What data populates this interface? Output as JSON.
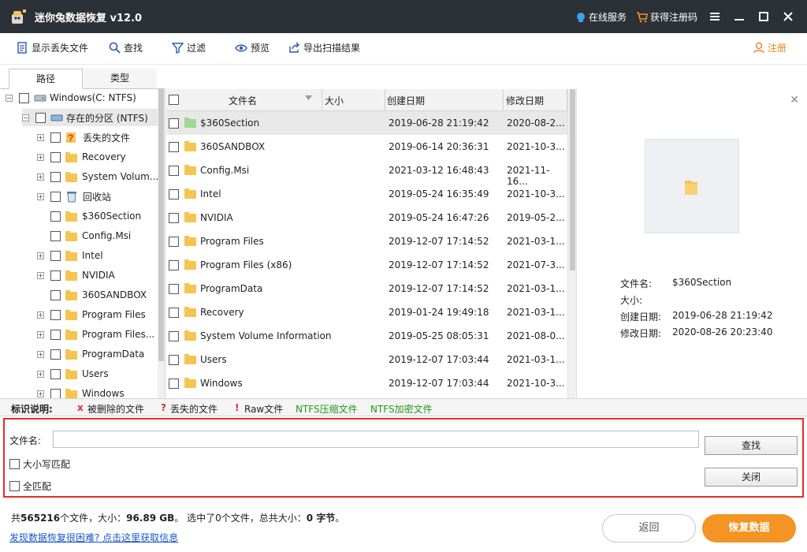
{
  "app": {
    "title": "迷你兔数据恢复 v12.0",
    "online_service": "在线服务",
    "get_code": "获得注册码"
  },
  "toolbar": {
    "show_lost": "显示丢失文件",
    "find": "查找",
    "filter": "过滤",
    "preview": "预览",
    "export": "导出扫描结果",
    "register": "注册"
  },
  "tabs": {
    "path": "路径",
    "type": "类型"
  },
  "tree": {
    "root": "Windows(C: NTFS)",
    "partition": "存在的分区 (NTFS)",
    "items": [
      "丢失的文件",
      "Recovery",
      "System Volum...",
      "回收站",
      "$360Section",
      "Config.Msi",
      "Intel",
      "NVIDIA",
      "360SANDBOX",
      "Program Files",
      "Program Files...",
      "ProgramData",
      "Users",
      "Windows"
    ]
  },
  "list": {
    "headers": {
      "name": "文件名",
      "size": "大小",
      "created": "创建日期",
      "modified": "修改日期"
    },
    "rows": [
      {
        "name": "$360Section",
        "created": "2019-06-28 21:19:42",
        "modified": "2020-08-2..."
      },
      {
        "name": "360SANDBOX",
        "created": "2019-06-14 20:36:31",
        "modified": "2021-10-3..."
      },
      {
        "name": "Config.Msi",
        "created": "2021-03-12 16:48:43",
        "modified": "2021-11-16..."
      },
      {
        "name": "Intel",
        "created": "2019-05-24 16:35:49",
        "modified": "2021-10-3..."
      },
      {
        "name": "NVIDIA",
        "created": "2019-05-24 16:47:26",
        "modified": "2019-05-2..."
      },
      {
        "name": "Program Files",
        "created": "2019-12-07 17:14:52",
        "modified": "2021-03-1..."
      },
      {
        "name": "Program Files (x86)",
        "created": "2019-12-07 17:14:52",
        "modified": "2021-07-3..."
      },
      {
        "name": "ProgramData",
        "created": "2019-12-07 17:14:52",
        "modified": "2021-03-1..."
      },
      {
        "name": "Recovery",
        "created": "2019-01-24 19:49:18",
        "modified": "2021-03-1..."
      },
      {
        "name": "System Volume Information",
        "created": "2019-05-25 08:05:31",
        "modified": "2021-08-0..."
      },
      {
        "name": "Users",
        "created": "2019-12-07 17:03:44",
        "modified": "2021-03-1..."
      },
      {
        "name": "Windows",
        "created": "2019-12-07 17:03:44",
        "modified": "2021-10-3..."
      }
    ]
  },
  "preview": {
    "labels": {
      "name": "文件名:",
      "size": "大小:",
      "created": "创建日期:",
      "modified": "修改日期:"
    },
    "values": {
      "name": "$360Section",
      "size": "",
      "created": "2019-06-28 21:19:42",
      "modified": "2020-08-26 20:23:40"
    }
  },
  "legend": {
    "title": "标识说明:",
    "deleted_mark": "x",
    "deleted": "被删除的文件",
    "lost_mark": "?",
    "lost": "丢失的文件",
    "raw_mark": "!",
    "raw": "Raw文件",
    "ntfs_comp": "NTFS压缩文件",
    "ntfs_enc": "NTFS加密文件"
  },
  "search": {
    "label": "文件名:",
    "value": "",
    "case": "大小写匹配",
    "whole": "全匹配",
    "find_btn": "查找",
    "close_btn": "关闭"
  },
  "status": {
    "prefix": "共",
    "count": "565216",
    "files": "个文件，大小：",
    "size": "96.89 GB",
    "selected_pre": "。 选中了",
    "selected": "0",
    "selected_mid": "个文件，总共大小：",
    "selected_size": "0 字节",
    "suffix": "。"
  },
  "help": "发现数据恢复很困难? 点击这里获取信息",
  "buttons": {
    "back": "返回",
    "recover": "恢复数据"
  },
  "colors": {
    "titlebar": "#2c3138",
    "accent": "#f39424",
    "green": "#1e9b1e",
    "red": "#e52b2b"
  }
}
